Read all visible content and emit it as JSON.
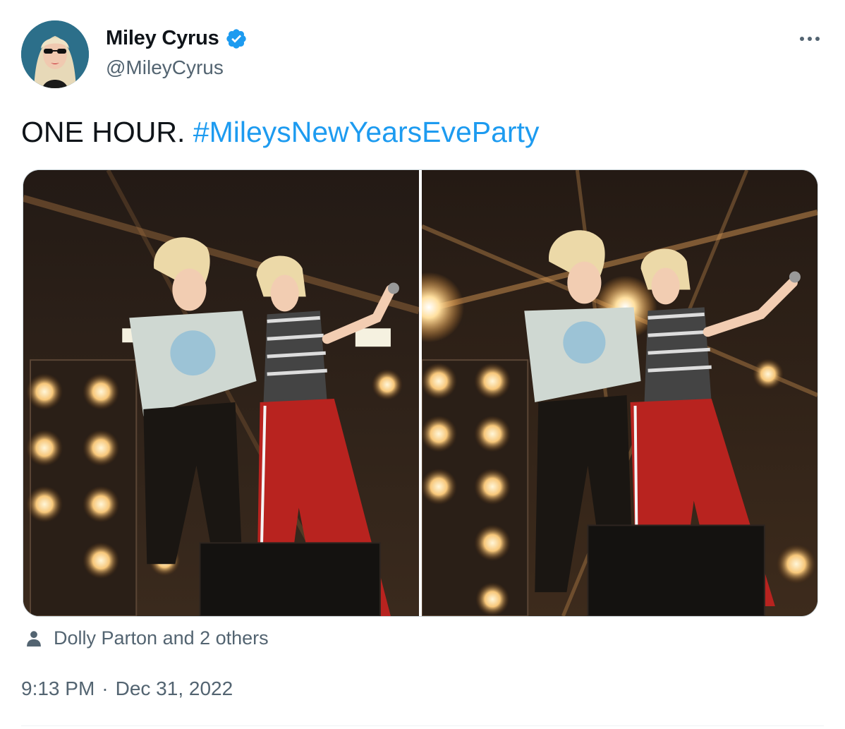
{
  "author": {
    "display_name": "Miley Cyrus",
    "handle": "@MileyCyrus",
    "verified": true,
    "avatar_icon": "profile-photo"
  },
  "tweet": {
    "text": "ONE HOUR.",
    "hashtag": "#MileysNewYearsEveParty",
    "media_count": 2
  },
  "tags": {
    "icon": "person-icon",
    "text": "Dolly Parton and 2 others"
  },
  "meta": {
    "time": "9:13 PM",
    "separator": "·",
    "date": "Dec 31, 2022"
  },
  "colors": {
    "link": "#1d9bf0",
    "secondary_text": "#536471",
    "primary_text": "#0f1419",
    "verified": "#1d9bf0"
  }
}
